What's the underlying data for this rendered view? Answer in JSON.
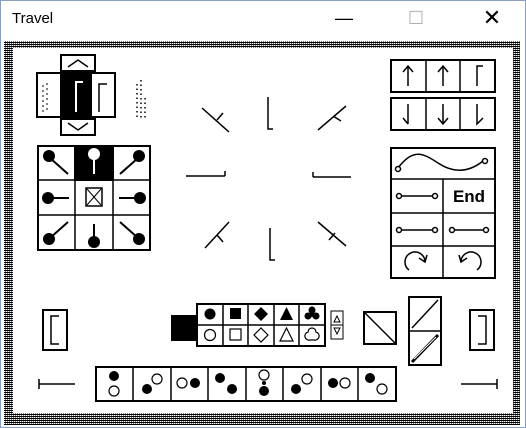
{
  "window": {
    "title": "Travel",
    "minimize_glyph": "—",
    "maximize_glyph": "☐",
    "close_glyph": "✕"
  },
  "controls": {
    "end_label": "End"
  },
  "colors": {
    "frame_dither": "#777777",
    "ink": "#000000",
    "window_border": "#8aa0c0"
  }
}
